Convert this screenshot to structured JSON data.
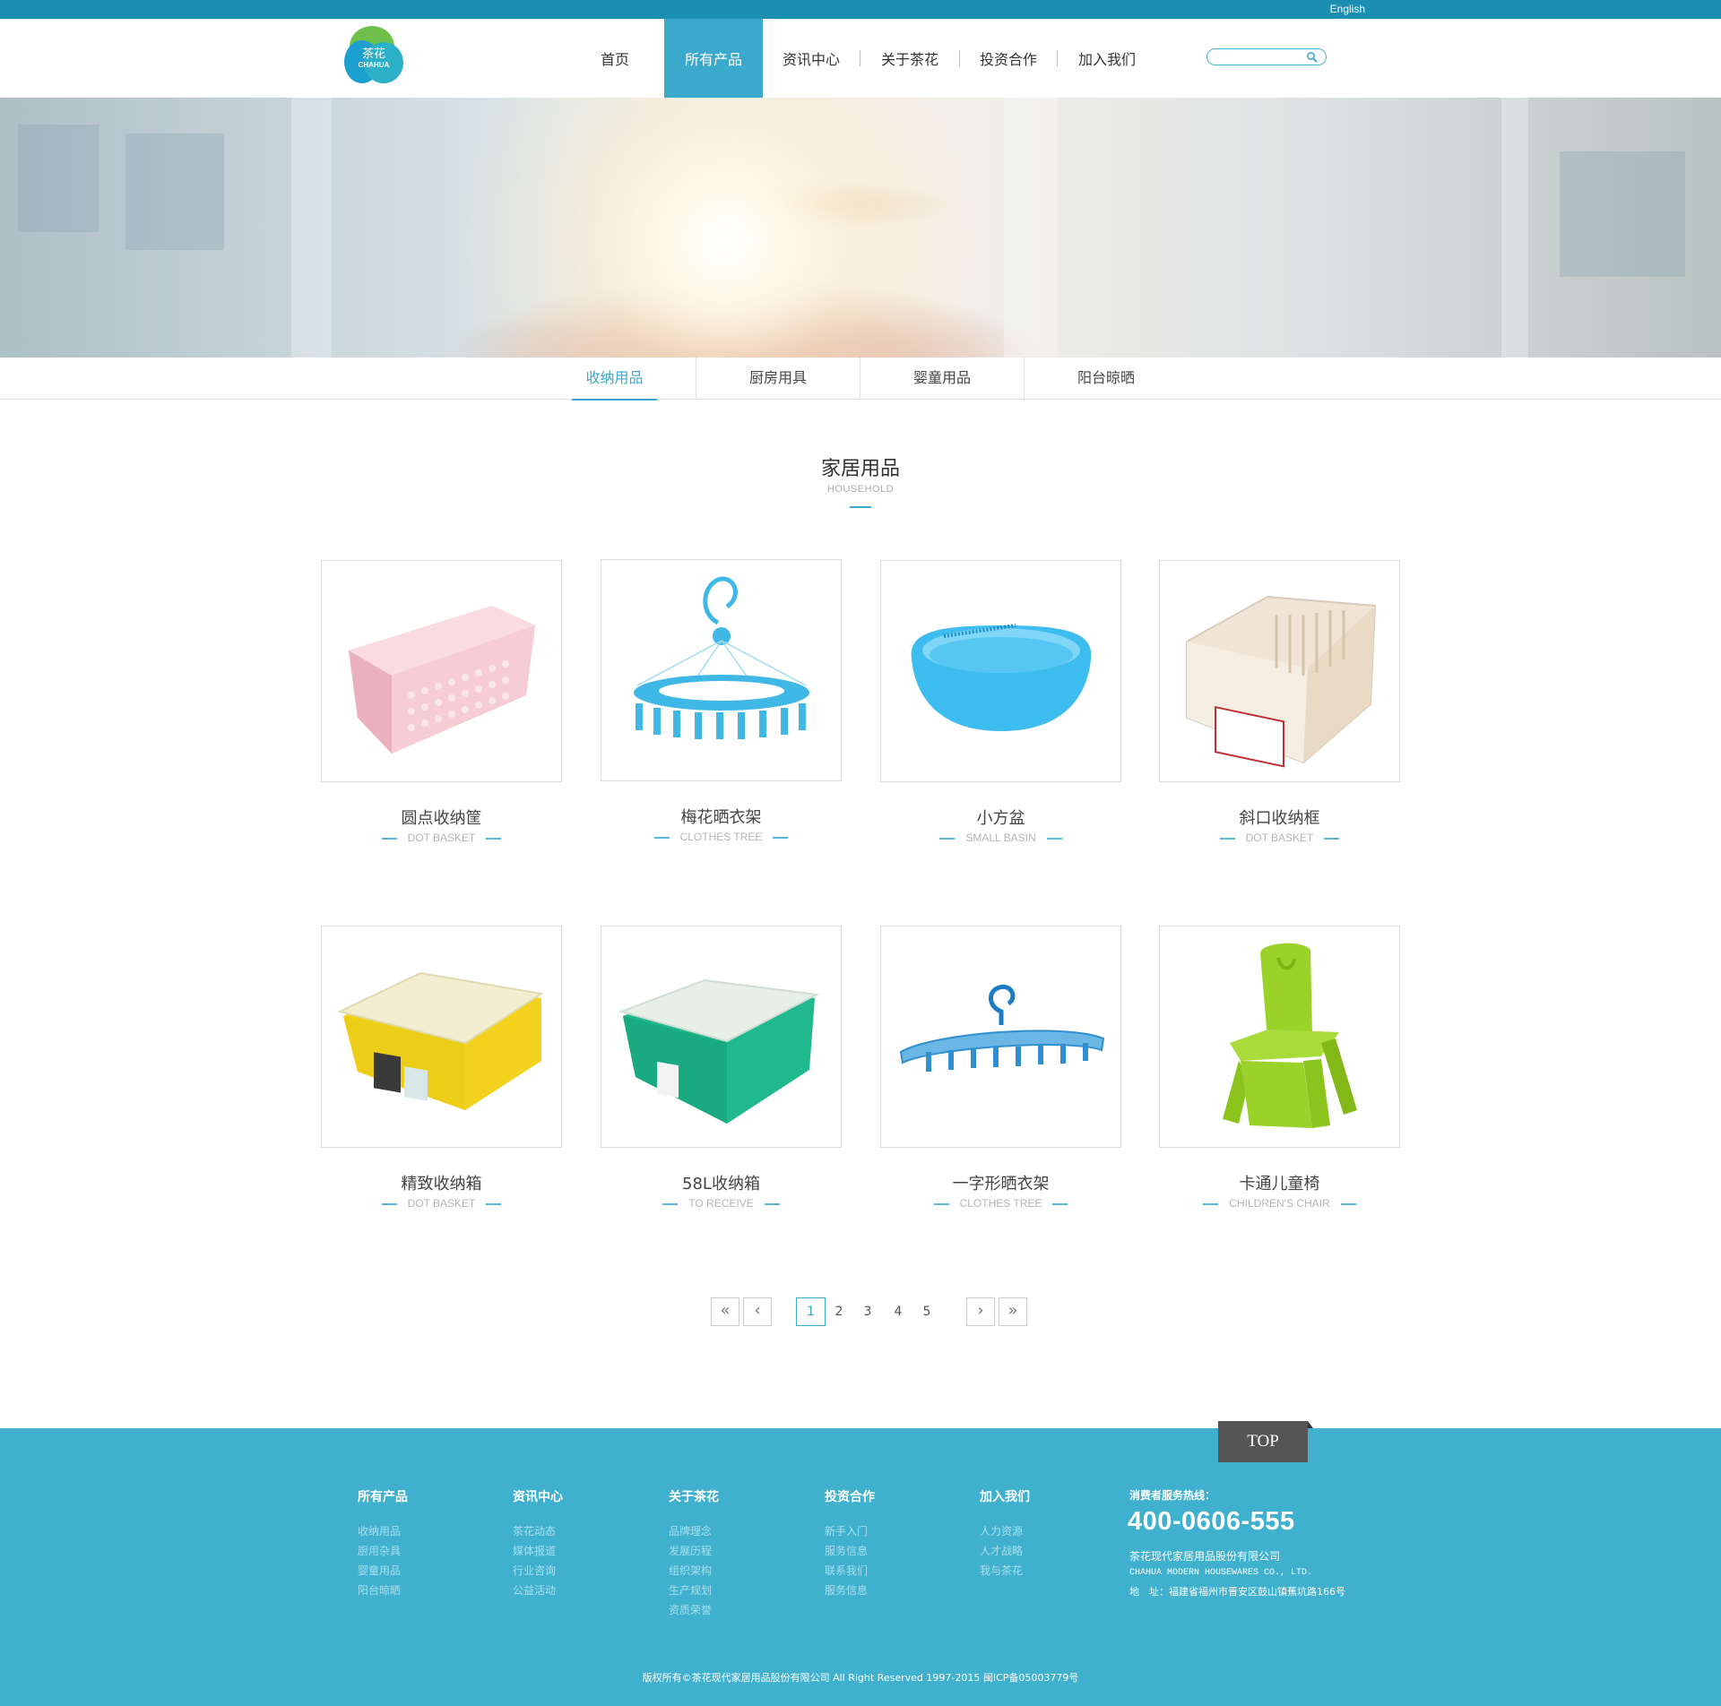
{
  "topbar": {
    "language_link": "English"
  },
  "logo": {
    "text_cn": "茶花",
    "text_en": "CHAHUA"
  },
  "nav": {
    "items": [
      {
        "label": "首页"
      },
      {
        "label": "所有产品"
      },
      {
        "label": "资讯中心"
      },
      {
        "label": "关于茶花"
      },
      {
        "label": "投资合作"
      },
      {
        "label": "加入我们"
      }
    ],
    "active_index": 1
  },
  "search": {
    "placeholder": "",
    "value": ""
  },
  "subtabs": {
    "items": [
      "收纳用品",
      "厨房用具",
      "婴童用品",
      "阳台晾晒"
    ],
    "active_index": 0
  },
  "section": {
    "title": "家居用品",
    "subtitle": "HOUSEHOLD"
  },
  "products": [
    {
      "name": "圆点收纳筐",
      "en": "DOT BASKET",
      "color": "#f2b9c5"
    },
    {
      "name": "梅花晒衣架",
      "en": "CLOTHES TREE",
      "color": "#3fb8e6"
    },
    {
      "name": "小方盆",
      "en": "SMALL BASIN",
      "color": "#3cbcef"
    },
    {
      "name": "斜口收纳框",
      "en": "DOT BASKET",
      "color": "#efe4d6"
    },
    {
      "name": "精致收纳箱",
      "en": "DOT BASKET",
      "color": "#f2d21c"
    },
    {
      "name": "58L收纳箱",
      "en": "TO RECEIVE",
      "color": "#1fb98d"
    },
    {
      "name": "一字形晒衣架",
      "en": "CLOTHES TREE",
      "color": "#47a8e0"
    },
    {
      "name": "卡通儿童椅",
      "en": "CHILDREN'S CHAIR",
      "color": "#9bd22a"
    }
  ],
  "pagination": {
    "first": "«",
    "prev": "‹",
    "pages": [
      "1",
      "2",
      "3",
      "4",
      "5"
    ],
    "current": "1",
    "next": "›",
    "last": "»"
  },
  "footer": {
    "top_button": "TOP",
    "columns": [
      {
        "title": "所有产品",
        "links": [
          "收纳用品",
          "厨用杂具",
          "婴童用品",
          "阳台晾晒"
        ]
      },
      {
        "title": "资讯中心",
        "links": [
          "茶花动态",
          "媒体报道",
          "行业咨询",
          "公益活动"
        ]
      },
      {
        "title": "关于茶花",
        "links": [
          "品牌理念",
          "发展历程",
          "组织架构",
          "生产规划",
          "资质荣誉"
        ]
      },
      {
        "title": "投资合作",
        "links": [
          "新手入门",
          "服务信息",
          "联系我们",
          "服务信息"
        ]
      },
      {
        "title": "加入我们",
        "links": [
          "人力资源",
          "人才战略",
          "我与茶花"
        ]
      }
    ],
    "hotline_label": "消费者服务热线：",
    "hotline": "400-0606-555",
    "company_cn": "茶花现代家居用品股份有限公司",
    "company_en": "CHAHUA MODERN HOUSEWARES CO., LTD.",
    "address": "地　址：福建省福州市晋安区鼓山镇蕉坑路166号",
    "copyright": "版权所有©茶花现代家居用品股份有限公司 All Right Reserved 1997-2015 闽ICP备05003779号"
  }
}
